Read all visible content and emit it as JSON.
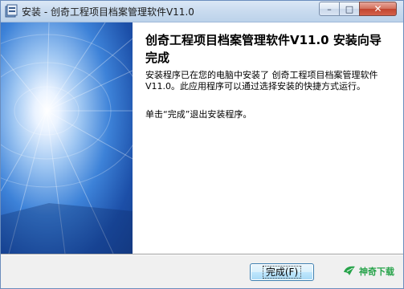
{
  "window": {
    "title": "安装 - 创奇工程项目档案管理软件V11.0",
    "minimize_icon": "minimize-icon",
    "maximize_icon": "maximize-icon",
    "close_icon": "close-icon"
  },
  "content": {
    "heading": "创奇工程项目档案管理软件V11.0 安装向导完成",
    "paragraph1": "安装程序已在您的电脑中安装了 创奇工程项目档案管理软件V11.0。此应用程序可以通过选择安装的快捷方式运行。",
    "paragraph2": "单击“完成”退出安装程序。"
  },
  "footer": {
    "finish_label": "完成(F)",
    "watermark_text": "神奇下载"
  },
  "colors": {
    "titlebar": "#c9dbef",
    "banner_blue": "#1c4fa8",
    "close_red": "#c2462f",
    "watermark_green": "#27a34a"
  }
}
